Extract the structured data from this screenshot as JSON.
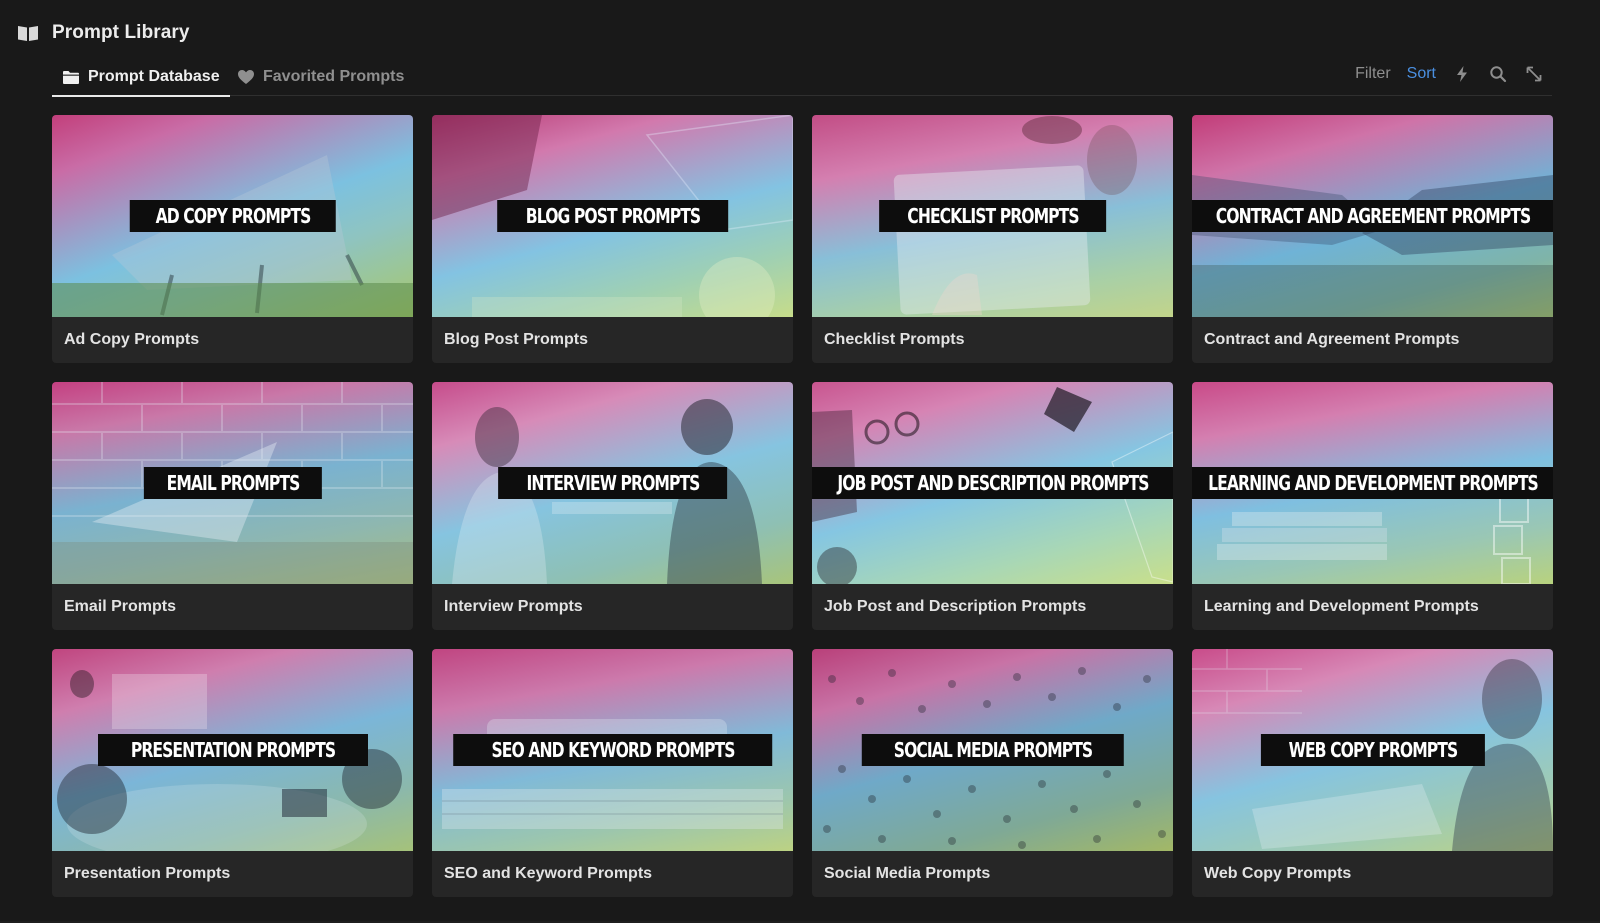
{
  "app": {
    "title": "Prompt Library",
    "title_icon": "book-open-icon"
  },
  "tabs": [
    {
      "label": "Prompt Database",
      "icon": "folder-icon",
      "active": true
    },
    {
      "label": "Favorited Prompts",
      "icon": "heart-icon",
      "active": false
    }
  ],
  "toolbar": {
    "filter_label": "Filter",
    "sort_label": "Sort",
    "icons": [
      "lightning-icon",
      "search-icon",
      "expand-arrows-icon"
    ]
  },
  "colors": {
    "background": "#191919",
    "card": "#262626",
    "accent": "#4a8fe0",
    "gradient_top": "#d8609a",
    "gradient_mid": "#6fb6d9",
    "gradient_bottom": "#b7d86a"
  },
  "cards": [
    {
      "banner": "AD COPY PROMPTS",
      "label": "Ad Copy Prompts"
    },
    {
      "banner": "BLOG POST PROMPTS",
      "label": "Blog Post Prompts"
    },
    {
      "banner": "CHECKLIST PROMPTS",
      "label": "Checklist Prompts"
    },
    {
      "banner": "CONTRACT AND AGREEMENT PROMPTS",
      "label": "Contract and Agreement Prompts"
    },
    {
      "banner": "EMAIL PROMPTS",
      "label": "Email Prompts"
    },
    {
      "banner": "INTERVIEW PROMPTS",
      "label": "Interview Prompts"
    },
    {
      "banner": "JOB POST AND DESCRIPTION PROMPTS",
      "label": "Job Post and Description Prompts"
    },
    {
      "banner": "LEARNING AND DEVELOPMENT PROMPTS",
      "label": "Learning and Development Prompts"
    },
    {
      "banner": "PRESENTATION PROMPTS",
      "label": "Presentation Prompts"
    },
    {
      "banner": "SEO AND KEYWORD PROMPTS",
      "label": "SEO and Keyword Prompts"
    },
    {
      "banner": "SOCIAL MEDIA PROMPTS",
      "label": "Social Media Prompts"
    },
    {
      "banner": "WEB COPY PROMPTS",
      "label": "Web Copy Prompts"
    }
  ]
}
